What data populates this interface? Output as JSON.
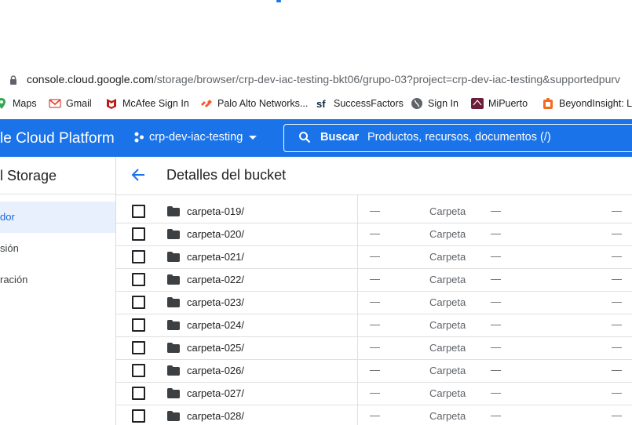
{
  "browser": {
    "url_host": "console.cloud.google.com",
    "url_path": "/storage/browser/crp-dev-iac-testing-bkt06/grupo-03?project=crp-dev-iac-testing&supportedpurv"
  },
  "bookmarks": [
    {
      "label": "Maps",
      "icon": "maps-icon"
    },
    {
      "label": "Gmail",
      "icon": "gmail-icon"
    },
    {
      "label": "McAfee Sign In",
      "icon": "mcafee-icon"
    },
    {
      "label": "Palo Alto Networks...",
      "icon": "paloalto-icon"
    },
    {
      "label": "SuccessFactors",
      "icon": "successfactors-icon"
    },
    {
      "label": "Sign In",
      "icon": "globe-icon"
    },
    {
      "label": "MiPuerto",
      "icon": "mipuerto-icon"
    },
    {
      "label": "BeyondInsight: Lo",
      "icon": "beyondinsight-icon"
    }
  ],
  "header": {
    "title": "le Cloud Platform",
    "project": "crp-dev-iac-testing",
    "search_button": "Buscar",
    "search_placeholder": "Productos, recursos, documentos (/)",
    "brand_color": "#1a73e8"
  },
  "sidebar": {
    "title": "l Storage",
    "items": [
      {
        "label": "dor",
        "active": true
      },
      {
        "label": "sión",
        "active": false
      },
      {
        "label": "ración",
        "active": false
      }
    ]
  },
  "page": {
    "title": "Detalles del bucket"
  },
  "rows": [
    {
      "name": "carpeta-019/",
      "size": "—",
      "type": "Carpeta",
      "created": "—",
      "other": "—"
    },
    {
      "name": "carpeta-020/",
      "size": "—",
      "type": "Carpeta",
      "created": "—",
      "other": "—"
    },
    {
      "name": "carpeta-021/",
      "size": "—",
      "type": "Carpeta",
      "created": "—",
      "other": "—"
    },
    {
      "name": "carpeta-022/",
      "size": "—",
      "type": "Carpeta",
      "created": "—",
      "other": "—"
    },
    {
      "name": "carpeta-023/",
      "size": "—",
      "type": "Carpeta",
      "created": "—",
      "other": "—"
    },
    {
      "name": "carpeta-024/",
      "size": "—",
      "type": "Carpeta",
      "created": "—",
      "other": "—"
    },
    {
      "name": "carpeta-025/",
      "size": "—",
      "type": "Carpeta",
      "created": "—",
      "other": "—"
    },
    {
      "name": "carpeta-026/",
      "size": "—",
      "type": "Carpeta",
      "created": "—",
      "other": "—"
    },
    {
      "name": "carpeta-027/",
      "size": "—",
      "type": "Carpeta",
      "created": "—",
      "other": "—"
    },
    {
      "name": "carpeta-028/",
      "size": "—",
      "type": "Carpeta",
      "created": "—",
      "other": "—"
    }
  ]
}
